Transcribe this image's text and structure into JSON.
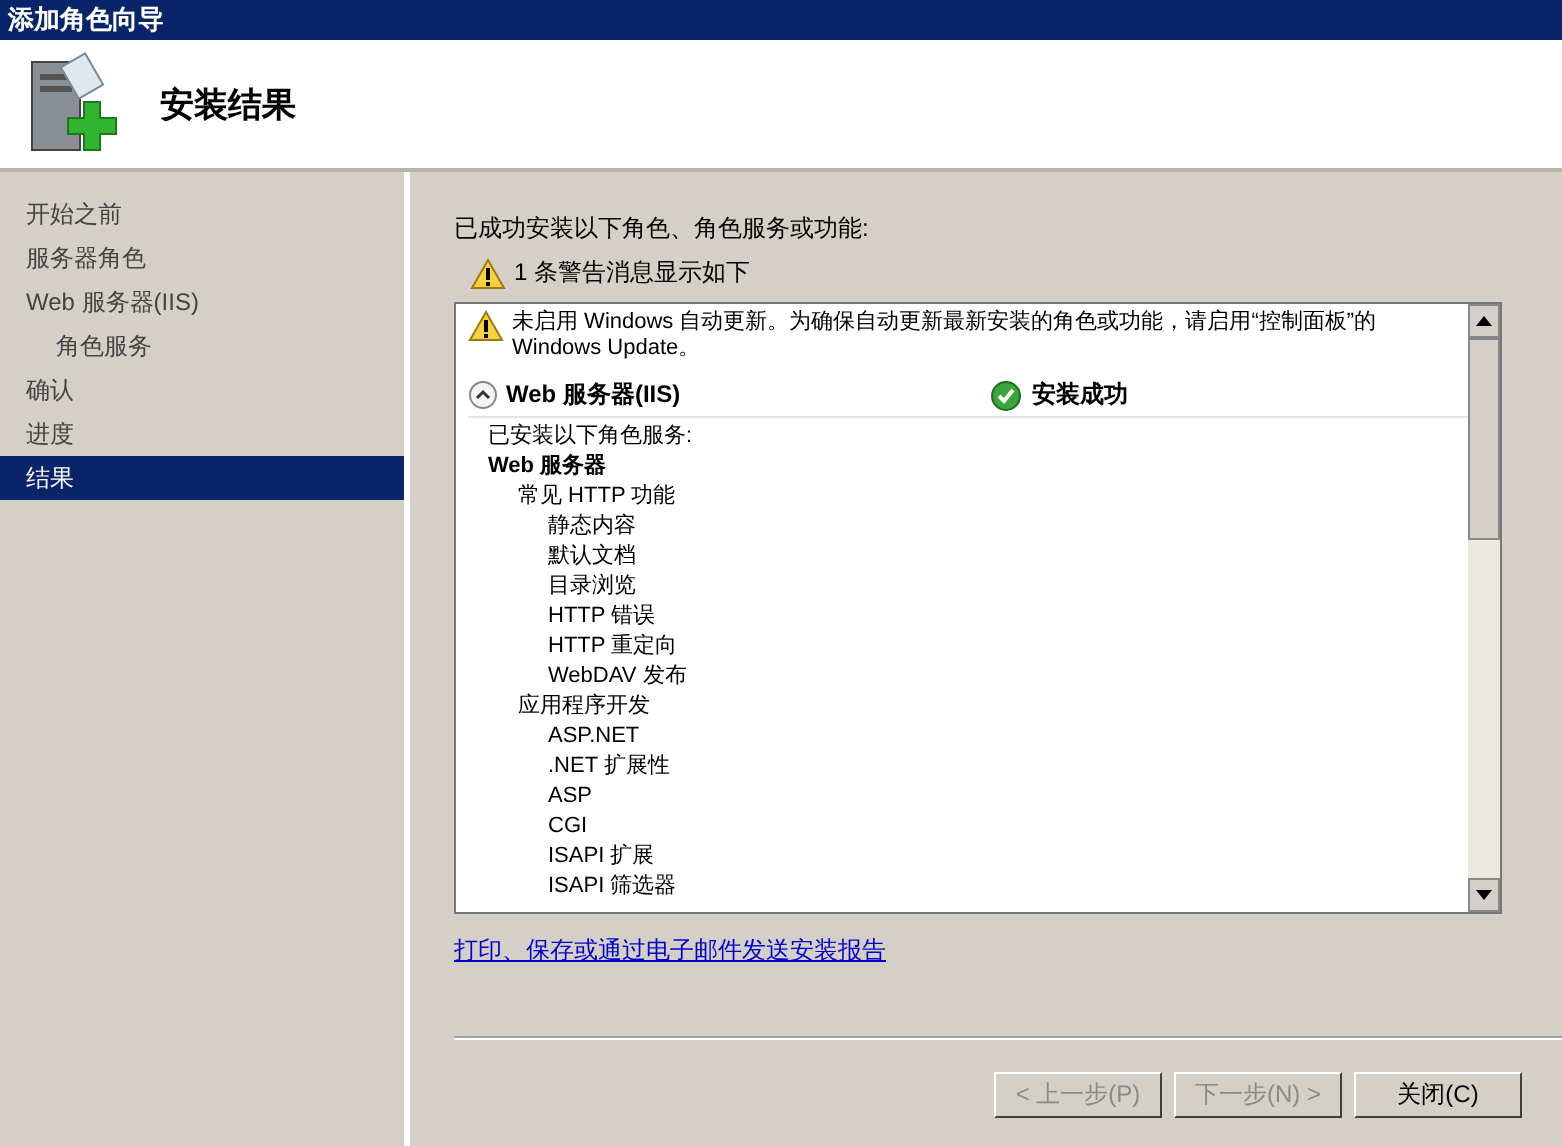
{
  "window": {
    "title": "添加角色向导"
  },
  "header": {
    "title": "安装结果"
  },
  "sidebar": {
    "items": [
      {
        "label": "开始之前",
        "selected": false
      },
      {
        "label": "服务器角色",
        "selected": false
      },
      {
        "label": "Web 服务器(IIS)",
        "selected": false,
        "children": [
          {
            "label": "角色服务",
            "selected": false
          }
        ]
      },
      {
        "label": "确认",
        "selected": false
      },
      {
        "label": "进度",
        "selected": false
      },
      {
        "label": "结果",
        "selected": true
      }
    ]
  },
  "content": {
    "intro": "已成功安装以下角色、角色服务或功能:",
    "warning_count": "1 条警告消息显示如下",
    "results": {
      "warning": "未启用 Windows 自动更新。为确保自动更新最新安装的角色或功能，请启用“控制面板”的 Windows Update。",
      "role": {
        "name": "Web 服务器(IIS)",
        "expanded": true,
        "status": "安装成功",
        "subtitle": "已安装以下角色服务:",
        "tree": [
          {
            "label": "Web 服务器",
            "children": [
              {
                "label": "常见 HTTP 功能",
                "children": [
                  {
                    "label": "静态内容"
                  },
                  {
                    "label": "默认文档"
                  },
                  {
                    "label": "目录浏览"
                  },
                  {
                    "label": "HTTP 错误"
                  },
                  {
                    "label": "HTTP 重定向"
                  },
                  {
                    "label": "WebDAV 发布"
                  }
                ]
              },
              {
                "label": "应用程序开发",
                "children": [
                  {
                    "label": "ASP.NET"
                  },
                  {
                    "label": ".NET 扩展性"
                  },
                  {
                    "label": "ASP"
                  },
                  {
                    "label": "CGI"
                  },
                  {
                    "label": "ISAPI 扩展"
                  },
                  {
                    "label": "ISAPI 筛选器"
                  }
                ]
              }
            ]
          }
        ]
      }
    },
    "report_link": "打印、保存或通过电子邮件发送安装报告"
  },
  "buttons": [
    {
      "label": "< 上一步(P)",
      "disabled": true
    },
    {
      "label": "下一步(N) >",
      "disabled": true
    },
    {
      "label": "关闭(C)",
      "disabled": false
    }
  ]
}
